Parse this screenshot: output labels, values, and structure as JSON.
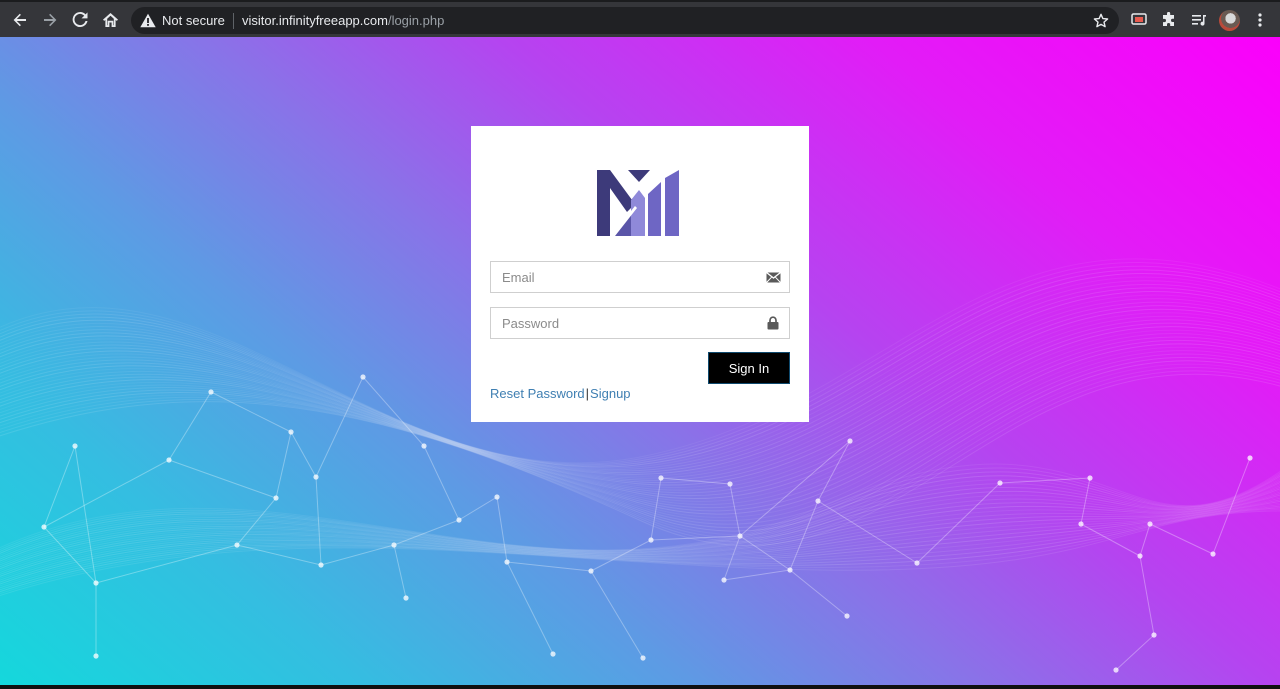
{
  "browser": {
    "security_label": "Not secure",
    "url_host": "visitor.infinityfreeapp.com",
    "url_path": "/login.php",
    "icons": [
      "back-icon",
      "forward-icon",
      "reload-icon",
      "home-icon",
      "warning-icon",
      "star-icon",
      "cast-icon",
      "extensions-icon",
      "reading-list-icon",
      "profile-avatar",
      "kebab-menu-icon"
    ]
  },
  "login": {
    "email_placeholder": "Email",
    "password_placeholder": "Password",
    "signin_label": "Sign In",
    "reset_label": "Reset Password",
    "separator": "|",
    "signup_label": "Signup"
  },
  "colors": {
    "gradient_top_right": "#fb00fb",
    "gradient_bottom_left": "#14d8dc",
    "button_bg": "#000000",
    "link": "#3f7fb2",
    "logo_dark": "#3d3a7a",
    "logo_light": "#7068c8"
  }
}
